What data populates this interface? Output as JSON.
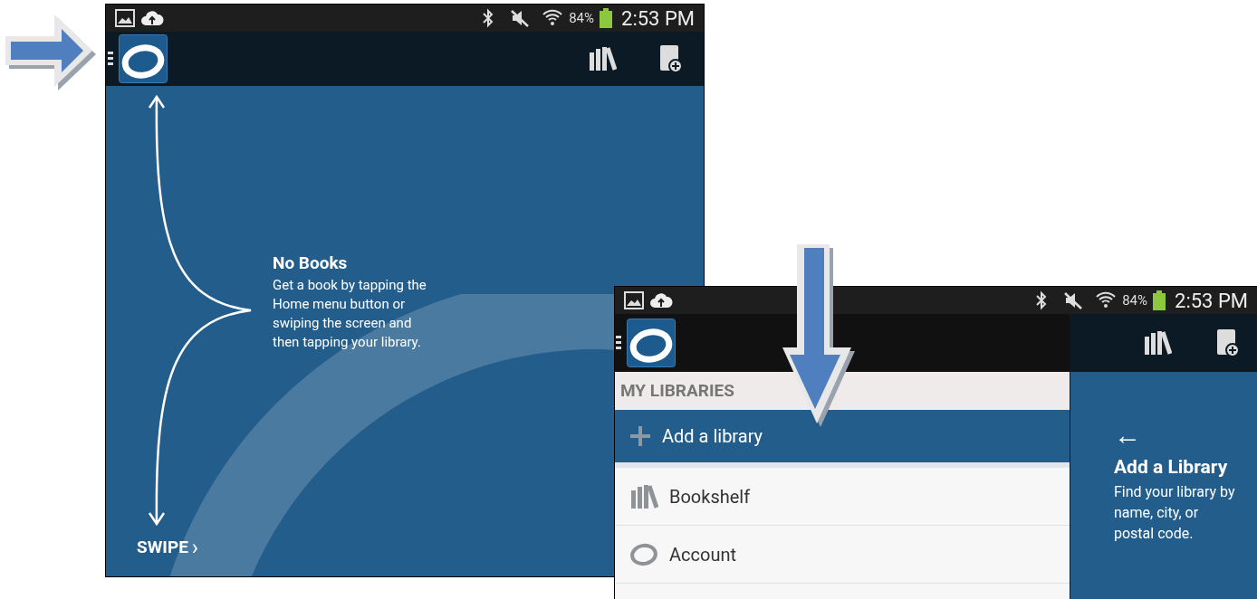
{
  "home_screen": {
    "status_bar": {
      "battery": "84%",
      "time": "2:53 PM"
    },
    "empty_state": {
      "title": "No Books",
      "message": "Get a book by tapping the Home menu button or swiping the screen and then tapping your library."
    },
    "swipe_hint": {
      "label": "SWIPE",
      "chevron": "›"
    }
  },
  "menu_screen": {
    "status_bar": {
      "battery": "84%",
      "time": "2:53 PM"
    },
    "drawer": {
      "heading": "MY LIBRARIES",
      "items": [
        {
          "label": "Add a library",
          "kind": "add",
          "selected": true
        },
        {
          "label": "Bookshelf",
          "kind": "bookshelf",
          "selected": false
        },
        {
          "label": "Account",
          "kind": "account",
          "selected": false
        }
      ]
    },
    "side_panel": {
      "arrow": "←",
      "title": "Add a Library",
      "message": "Find your library by name, city, or postal code."
    }
  }
}
